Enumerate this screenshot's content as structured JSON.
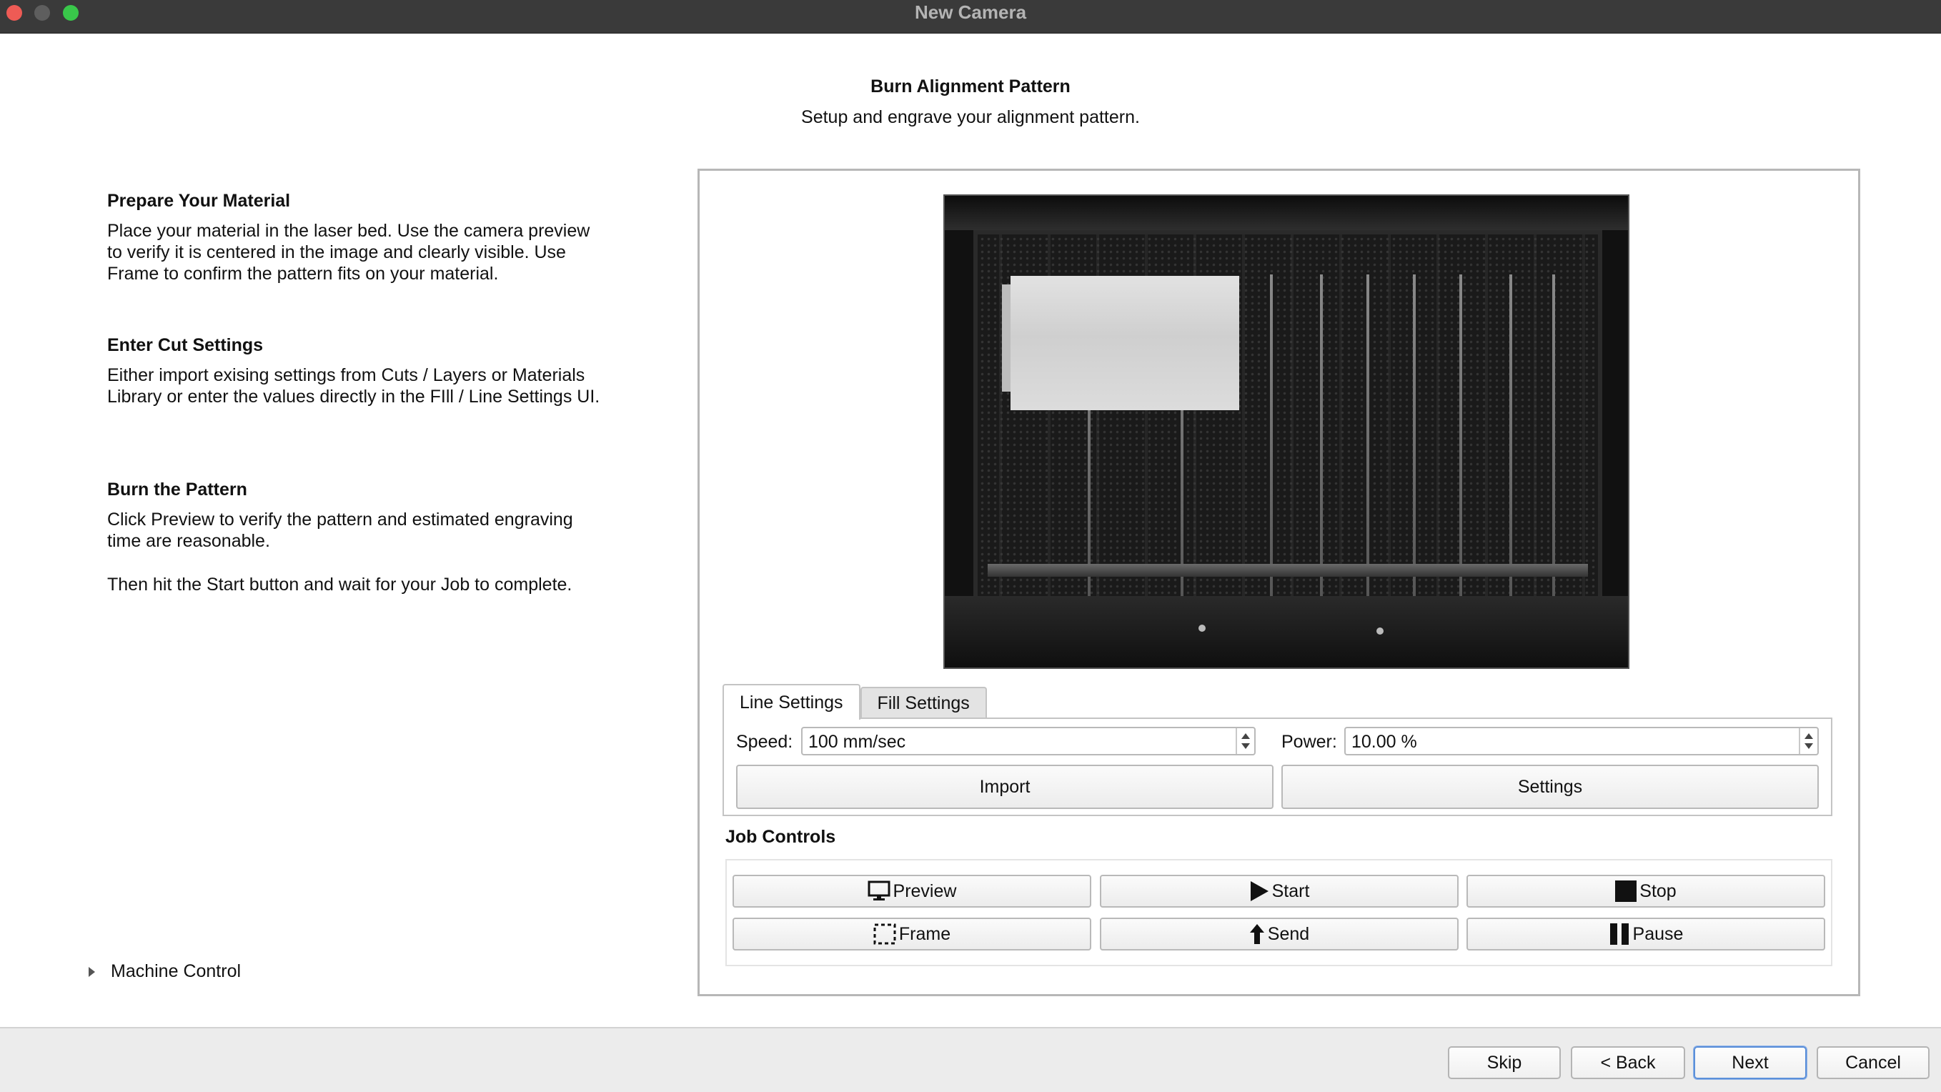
{
  "window": {
    "title": "New Camera"
  },
  "header": {
    "title": "Burn Alignment Pattern",
    "subtitle": "Setup and engrave your alignment pattern."
  },
  "instructions": {
    "prepare": {
      "title": "Prepare Your Material",
      "body": "Place your material in the laser bed. Use the camera preview to verify it is centered in the image and clearly visible. Use Frame to confirm the pattern fits on your material."
    },
    "cut_settings": {
      "title": "Enter Cut Settings",
      "body": "Either import exising settings from Cuts / Layers or Materials Library or enter the values directly in the FIll / Line Settings UI."
    },
    "burn": {
      "title": "Burn the Pattern",
      "body": "Click Preview to verify the pattern and estimated engraving time are reasonable.",
      "body2": "Then hit the Start button and wait for your Job to complete."
    }
  },
  "machine_control": {
    "label": "Machine Control"
  },
  "settings_tabs": {
    "tabs": [
      {
        "label": "Line Settings",
        "active": true
      },
      {
        "label": "Fill Settings",
        "active": false
      }
    ],
    "speed_label": "Speed:",
    "speed_value": "100 mm/sec",
    "power_label": "Power:",
    "power_value": "10.00 %",
    "import_label": "Import",
    "settings_label": "Settings"
  },
  "job_controls": {
    "title": "Job Controls",
    "preview": "Preview",
    "start": "Start",
    "stop": "Stop",
    "frame": "Frame",
    "send": "Send",
    "pause": "Pause"
  },
  "footer": {
    "skip": "Skip",
    "back": "< Back",
    "next": "Next",
    "cancel": "Cancel"
  },
  "colors": {
    "titlebar": "#3a3a3a",
    "close": "#ee5b55",
    "minimize": "#5e5e5e",
    "maximize": "#39c74a",
    "default_button_border": "#5b8fd9"
  },
  "icons": {
    "preview": "monitor-icon",
    "start": "play-icon",
    "stop": "stop-icon",
    "frame": "frame-icon",
    "send": "arrow-up-icon",
    "pause": "pause-icon",
    "disclosure": "triangle-right-icon"
  }
}
